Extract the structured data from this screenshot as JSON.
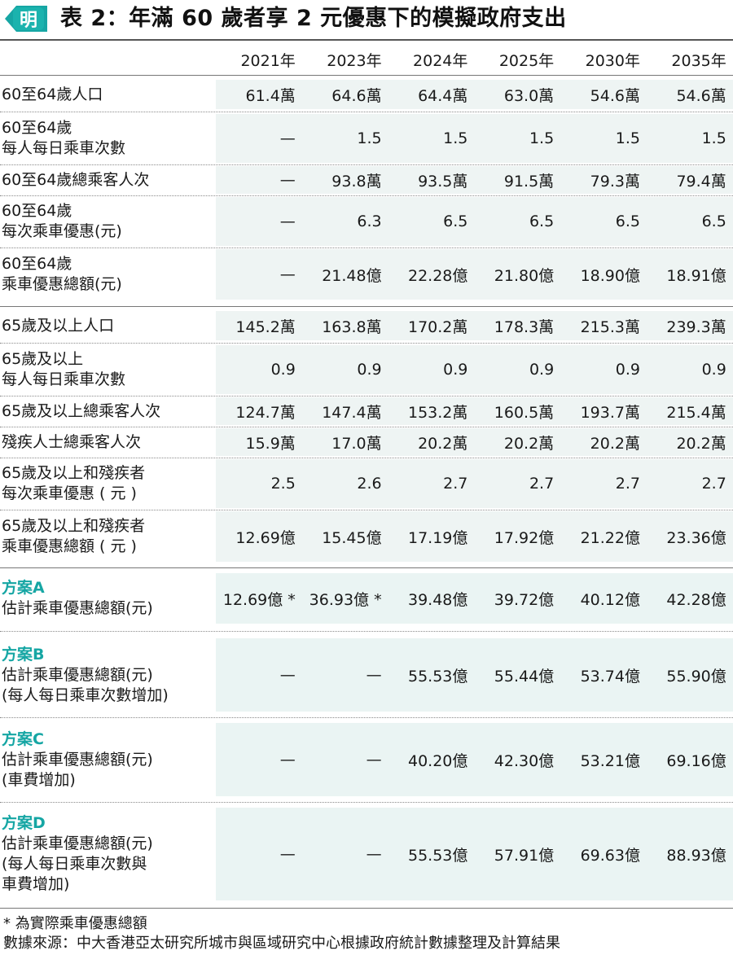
{
  "header": {
    "logo_text": "明",
    "title": "表 2：年滿 60 歲者享 2 元優惠下的模擬政府支出"
  },
  "columns": [
    "2021年",
    "2023年",
    "2024年",
    "2025年",
    "2030年",
    "2035年"
  ],
  "rows": [
    {
      "label": [
        "60至64歲人口"
      ],
      "values": [
        "61.4萬",
        "64.6萬",
        "64.4萬",
        "63.0萬",
        "54.6萬",
        "54.6萬"
      ]
    },
    {
      "label": [
        "60至64歲",
        "每人每日乘車次數"
      ],
      "values": [
        "—",
        "1.5",
        "1.5",
        "1.5",
        "1.5",
        "1.5"
      ]
    },
    {
      "label": [
        "60至64歲總乘客人次"
      ],
      "values": [
        "—",
        "93.8萬",
        "93.5萬",
        "91.5萬",
        "79.3萬",
        "79.4萬"
      ]
    },
    {
      "label": [
        "60至64歲",
        "每次乘車優惠(元)"
      ],
      "values": [
        "—",
        "6.3",
        "6.5",
        "6.5",
        "6.5",
        "6.5"
      ]
    },
    {
      "label": [
        "60至64歲",
        "乘車優惠總額(元)"
      ],
      "values": [
        "—",
        "21.48億",
        "22.28億",
        "21.80億",
        "18.90億",
        "18.91億"
      ]
    },
    {
      "label": [
        "65歲及以上人口"
      ],
      "values": [
        "145.2萬",
        "163.8萬",
        "170.2萬",
        "178.3萬",
        "215.3萬",
        "239.3萬"
      ]
    },
    {
      "label": [
        "65歲及以上",
        "每人每日乘車次數"
      ],
      "values": [
        "0.9",
        "0.9",
        "0.9",
        "0.9",
        "0.9",
        "0.9"
      ]
    },
    {
      "label": [
        "65歲及以上總乘客人次"
      ],
      "values": [
        "124.7萬",
        "147.4萬",
        "153.2萬",
        "160.5萬",
        "193.7萬",
        "215.4萬"
      ]
    },
    {
      "label": [
        "殘疾人士總乘客人次"
      ],
      "values": [
        "15.9萬",
        "17.0萬",
        "20.2萬",
        "20.2萬",
        "20.2萬",
        "20.2萬"
      ]
    },
    {
      "label": [
        "65歲及以上和殘疾者",
        "每次乘車優惠 ( 元 )"
      ],
      "values": [
        "2.5",
        "2.6",
        "2.7",
        "2.7",
        "2.7",
        "2.7"
      ]
    },
    {
      "label": [
        "65歲及以上和殘疾者",
        "乘車優惠總額 ( 元 )"
      ],
      "values": [
        "12.69億",
        "15.45億",
        "17.19億",
        "17.92億",
        "21.22億",
        "23.36億"
      ]
    },
    {
      "scheme": "方案A",
      "label": [
        "估計乘車優惠總額(元)"
      ],
      "values": [
        "12.69億 *",
        "36.93億 *",
        "39.48億",
        "39.72億",
        "40.12億",
        "42.28億"
      ]
    },
    {
      "scheme": "方案B",
      "label": [
        "估計乘車優惠總額(元)",
        "(每人每日乘車次數增加)"
      ],
      "values": [
        "—",
        "—",
        "55.53億",
        "55.44億",
        "53.74億",
        "55.90億"
      ]
    },
    {
      "scheme": "方案C",
      "label": [
        "估計乘車優惠總額(元)",
        "(車費增加)"
      ],
      "values": [
        "—",
        "—",
        "40.20億",
        "42.30億",
        "53.21億",
        "69.16億"
      ]
    },
    {
      "scheme": "方案D",
      "label": [
        "估計乘車優惠總額(元)",
        "(每人每日乘車次數與",
        "車費增加)"
      ],
      "values": [
        "—",
        "—",
        "55.53億",
        "57.91億",
        "69.63億",
        "88.93億"
      ]
    }
  ],
  "footnotes": {
    "note": "* 為實際乘車優惠總額",
    "source": "數據來源：中大香港亞太研究所城市與區域研究中心根據政府統計數據整理及計算結果"
  },
  "colors": {
    "accent_teal": "#16a6a4",
    "cell_shade": "#eef4f3"
  }
}
